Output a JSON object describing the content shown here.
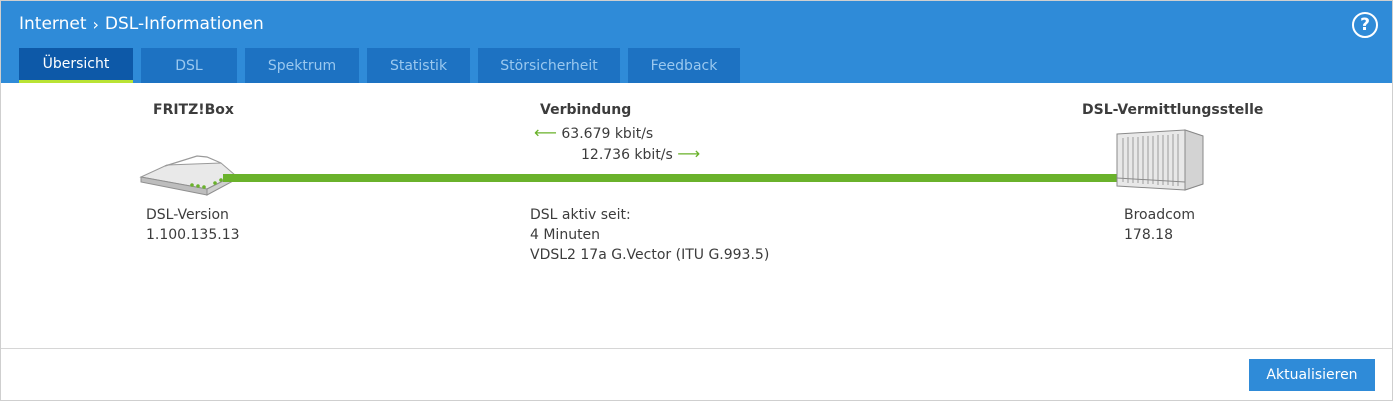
{
  "header": {
    "breadcrumb": [
      "Internet",
      "DSL-Informationen"
    ],
    "help_label": "?"
  },
  "tabs": [
    {
      "label": "Übersicht",
      "active": true
    },
    {
      "label": "DSL",
      "active": false
    },
    {
      "label": "Spektrum",
      "active": false
    },
    {
      "label": "Statistik",
      "active": false
    },
    {
      "label": "Störsicherheit",
      "active": false
    },
    {
      "label": "Feedback",
      "active": false
    }
  ],
  "overview": {
    "left": {
      "title": "FRITZ!Box",
      "version_label": "DSL-Version",
      "version": "1.100.135.13"
    },
    "center": {
      "title": "Verbindung",
      "downstream": "63.679 kbit/s",
      "upstream": "12.736 kbit/s",
      "active_label": "DSL aktiv seit:",
      "duration": "4 Minuten",
      "mode": "VDSL2 17a G.Vector (ITU G.993.5)"
    },
    "right": {
      "title": "DSL-Vermittlungsstelle",
      "vendor": "Broadcom",
      "version": "178.18"
    }
  },
  "footer": {
    "refresh_label": "Aktualisieren"
  },
  "colors": {
    "header": "#2f8bd8",
    "tab": "#1d72c2",
    "tab_active": "#0d59a8",
    "accent": "#b9e334",
    "line": "#6ab22b"
  }
}
